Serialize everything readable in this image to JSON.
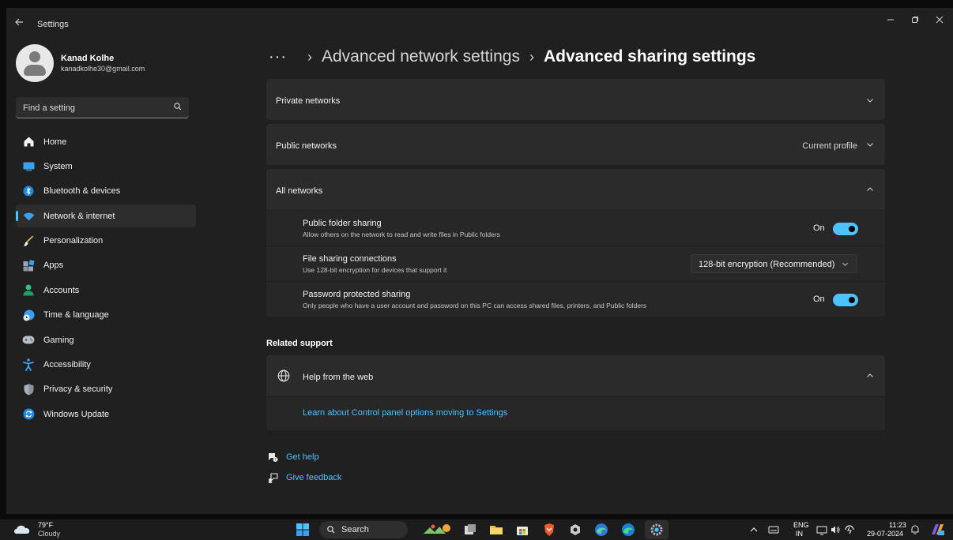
{
  "window": {
    "app_title": "Settings",
    "controls": [
      "minimize",
      "restore",
      "close"
    ]
  },
  "profile": {
    "name": "Kanad Kolhe",
    "email": "kanadkolhe30@gmail.com"
  },
  "search": {
    "placeholder": "Find a setting"
  },
  "nav": [
    {
      "label": "Home",
      "icon": "home-icon"
    },
    {
      "label": "System",
      "icon": "system-icon"
    },
    {
      "label": "Bluetooth & devices",
      "icon": "bluetooth-icon"
    },
    {
      "label": "Network & internet",
      "icon": "wifi-icon",
      "active": true
    },
    {
      "label": "Personalization",
      "icon": "brush-icon"
    },
    {
      "label": "Apps",
      "icon": "apps-icon"
    },
    {
      "label": "Accounts",
      "icon": "account-icon"
    },
    {
      "label": "Time & language",
      "icon": "globe-clock-icon"
    },
    {
      "label": "Gaming",
      "icon": "gamepad-icon"
    },
    {
      "label": "Accessibility",
      "icon": "accessibility-icon"
    },
    {
      "label": "Privacy & security",
      "icon": "shield-icon"
    },
    {
      "label": "Windows Update",
      "icon": "update-icon"
    }
  ],
  "breadcrumb": {
    "overflow": "···",
    "separator": "›",
    "parent": "Advanced network settings",
    "current": "Advanced sharing settings"
  },
  "sections": {
    "private": {
      "label": "Private networks"
    },
    "public": {
      "label": "Public networks",
      "badge": "Current profile"
    },
    "all": {
      "label": "All networks",
      "rows": {
        "public_folder": {
          "title": "Public folder sharing",
          "desc": "Allow others on the network to read and write files in Public folders",
          "state": "On"
        },
        "file_sharing": {
          "title": "File sharing connections",
          "desc": "Use 128-bit encryption for devices that support it",
          "value": "128-bit encryption (Recommended)"
        },
        "password": {
          "title": "Password protected sharing",
          "desc": "Only people who have a user account and password on this PC can access shared files, printers, and Public folders",
          "state": "On"
        }
      }
    }
  },
  "related": {
    "heading": "Related support",
    "help": {
      "label": "Help from the web",
      "link": "Learn about Control panel options moving to Settings"
    }
  },
  "footer": {
    "get_help": "Get help",
    "feedback": "Give feedback"
  },
  "taskbar": {
    "temp": "79°F",
    "condition": "Cloudy",
    "search": "Search",
    "lang_top": "ENG",
    "lang_bottom": "IN",
    "time": "11:23",
    "date": "29-07-2024"
  },
  "colors": {
    "accent": "#4cc2ff",
    "card": "#2b2b2b",
    "window": "#202020"
  }
}
